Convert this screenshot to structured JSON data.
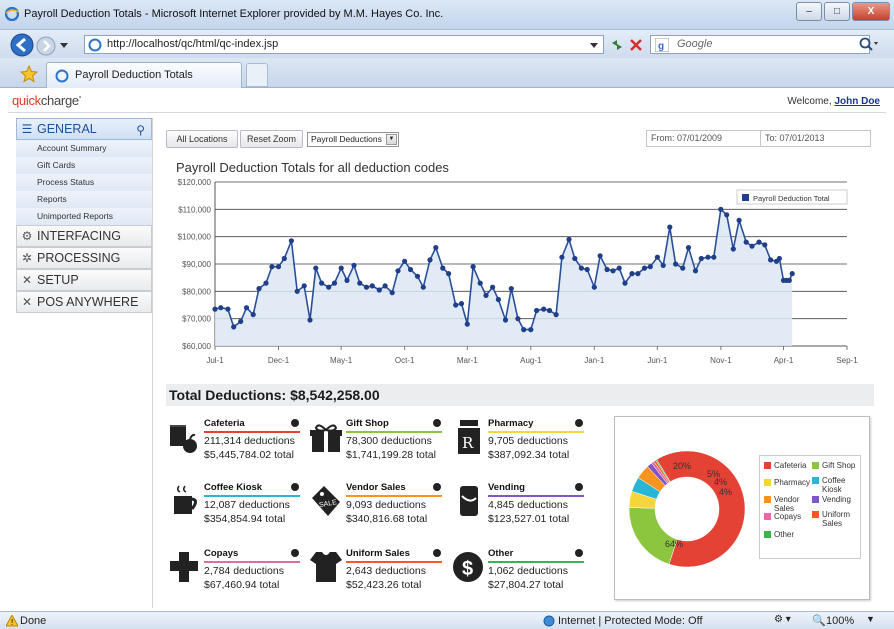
{
  "window": {
    "title": "Payroll Deduction Totals - Microsoft Internet Explorer provided by M.M. Hayes Co. Inc.",
    "minimize": "–",
    "maximize": "□",
    "close": "X"
  },
  "browser": {
    "url": "http://localhost/qc/html/qc-index.jsp",
    "search_placeholder": "Google",
    "tab_label": "Payroll Deduction Totals"
  },
  "app": {
    "logo_q": "quick",
    "logo_c": "charge",
    "logo_mark": "•",
    "welcome_prefix": "Welcome, ",
    "user_name": "John Doe"
  },
  "nav": {
    "general": "GENERAL",
    "general_items": [
      "Account Summary",
      "Gift Cards",
      "Process Status",
      "Reports",
      "Unimported Reports"
    ],
    "interfacing": "INTERFACING",
    "processing": "PROCESSING",
    "setup": "SETUP",
    "pos": "POS ANYWHERE"
  },
  "toolbar": {
    "all_locations": "All Locations",
    "reset_zoom": "Reset Zoom",
    "dropdown_value": "Payroll Deductions",
    "from_label": "From: ",
    "from_value": "07/01/2009",
    "to_label": "To: ",
    "to_value": "07/01/2013"
  },
  "chart_data": {
    "type": "area",
    "title": "Payroll Deduction Totals for all deduction codes",
    "series_name": "Payroll Deduction Total",
    "ylim": [
      60000,
      120000
    ],
    "y_ticks": [
      "$60,000",
      "$70,000",
      "$80,000",
      "$90,000",
      "$100,000",
      "$110,000",
      "$120,000"
    ],
    "y_tick_values": [
      60000,
      70000,
      80000,
      90000,
      100000,
      110000,
      120000
    ],
    "x_ticks": [
      "Jul-1",
      "Dec-1",
      "May-1",
      "Oct-1",
      "Mar-1",
      "Aug-1",
      "Jan-1",
      "Jun-1",
      "Nov-1",
      "Apr-1",
      "Sep-1"
    ],
    "x_tick_dates": [
      "2009-07-01",
      "2009-12-01",
      "2010-05-01",
      "2010-10-01",
      "2011-03-01",
      "2011-08-01",
      "2012-01-01",
      "2012-06-01",
      "2012-11-01",
      "2013-04-01",
      "2013-09-01"
    ],
    "x_range": [
      "2009-07-01",
      "2013-09-01"
    ],
    "points": [
      [
        "2009-07-01",
        73500
      ],
      [
        "2009-07-15",
        74000
      ],
      [
        "2009-08-01",
        73500
      ],
      [
        "2009-08-15",
        67000
      ],
      [
        "2009-09-01",
        69000
      ],
      [
        "2009-09-15",
        74000
      ],
      [
        "2009-10-01",
        71500
      ],
      [
        "2009-10-15",
        81000
      ],
      [
        "2009-11-01",
        83000
      ],
      [
        "2009-11-15",
        89000
      ],
      [
        "2009-12-01",
        89000
      ],
      [
        "2009-12-15",
        92000
      ],
      [
        "2010-01-01",
        98500
      ],
      [
        "2010-01-15",
        80000
      ],
      [
        "2010-02-01",
        82000
      ],
      [
        "2010-02-15",
        69500
      ],
      [
        "2010-03-01",
        88500
      ],
      [
        "2010-03-15",
        83000
      ],
      [
        "2010-04-01",
        81500
      ],
      [
        "2010-04-15",
        83000
      ],
      [
        "2010-05-01",
        88500
      ],
      [
        "2010-05-15",
        84000
      ],
      [
        "2010-06-01",
        89500
      ],
      [
        "2010-06-15",
        83000
      ],
      [
        "2010-07-01",
        81500
      ],
      [
        "2010-07-15",
        82000
      ],
      [
        "2010-08-01",
        80500
      ],
      [
        "2010-08-15",
        82000
      ],
      [
        "2010-09-01",
        79500
      ],
      [
        "2010-09-15",
        87500
      ],
      [
        "2010-10-01",
        91000
      ],
      [
        "2010-10-15",
        88000
      ],
      [
        "2010-11-01",
        85500
      ],
      [
        "2010-11-15",
        81500
      ],
      [
        "2010-12-01",
        91500
      ],
      [
        "2010-12-15",
        96000
      ],
      [
        "2011-01-01",
        88500
      ],
      [
        "2011-01-15",
        86500
      ],
      [
        "2011-02-01",
        75000
      ],
      [
        "2011-02-15",
        75500
      ],
      [
        "2011-03-01",
        68000
      ],
      [
        "2011-03-15",
        89000
      ],
      [
        "2011-04-01",
        83000
      ],
      [
        "2011-04-15",
        78500
      ],
      [
        "2011-05-01",
        81500
      ],
      [
        "2011-05-15",
        77000
      ],
      [
        "2011-06-01",
        69500
      ],
      [
        "2011-06-15",
        81000
      ],
      [
        "2011-07-01",
        70000
      ],
      [
        "2011-07-15",
        66000
      ],
      [
        "2011-08-01",
        66000
      ],
      [
        "2011-08-15",
        73000
      ],
      [
        "2011-09-01",
        73500
      ],
      [
        "2011-09-15",
        73000
      ],
      [
        "2011-10-01",
        71500
      ],
      [
        "2011-10-15",
        92500
      ],
      [
        "2011-11-01",
        99000
      ],
      [
        "2011-11-15",
        92000
      ],
      [
        "2011-12-01",
        88500
      ],
      [
        "2011-12-15",
        88000
      ],
      [
        "2012-01-01",
        81500
      ],
      [
        "2012-01-15",
        93000
      ],
      [
        "2012-02-01",
        88000
      ],
      [
        "2012-02-15",
        87500
      ],
      [
        "2012-03-01",
        88500
      ],
      [
        "2012-03-15",
        83000
      ],
      [
        "2012-04-01",
        86500
      ],
      [
        "2012-04-15",
        86500
      ],
      [
        "2012-05-01",
        88500
      ],
      [
        "2012-05-15",
        89000
      ],
      [
        "2012-06-01",
        92500
      ],
      [
        "2012-06-15",
        89500
      ],
      [
        "2012-07-01",
        103500
      ],
      [
        "2012-07-15",
        90000
      ],
      [
        "2012-08-01",
        88500
      ],
      [
        "2012-08-15",
        96000
      ],
      [
        "2012-09-01",
        87500
      ],
      [
        "2012-09-15",
        92000
      ],
      [
        "2012-10-01",
        92500
      ],
      [
        "2012-10-15",
        92500
      ],
      [
        "2012-11-01",
        110000
      ],
      [
        "2012-11-15",
        108000
      ],
      [
        "2012-12-01",
        95500
      ],
      [
        "2012-12-15",
        106000
      ],
      [
        "2013-01-01",
        98000
      ],
      [
        "2013-01-15",
        96500
      ],
      [
        "2013-02-01",
        98000
      ],
      [
        "2013-02-15",
        97000
      ],
      [
        "2013-03-01",
        91500
      ],
      [
        "2013-03-15",
        91000
      ],
      [
        "2013-03-22",
        92000
      ],
      [
        "2013-04-01",
        84000
      ],
      [
        "2013-04-08",
        84000
      ],
      [
        "2013-04-15",
        84000
      ],
      [
        "2013-04-22",
        86500
      ]
    ],
    "legend_position": "top-right",
    "grid": true
  },
  "totals": {
    "heading": "Total Deductions: $8,542,258.00"
  },
  "categories": [
    {
      "name": "Cafeteria",
      "count": "211,314 deductions",
      "total": "$5,445,784.02 total",
      "color": "#e34234",
      "icon": "cup-apple-icon"
    },
    {
      "name": "Gift Shop",
      "count": "78,300 deductions",
      "total": "$1,741,199.28 total",
      "color": "#8cc63f",
      "icon": "gift-box-icon"
    },
    {
      "name": "Pharmacy",
      "count": "9,705 deductions",
      "total": "$387,092.34 total",
      "color": "#f5d53b",
      "icon": "rx-bottle-icon"
    },
    {
      "name": "Coffee Kiosk",
      "count": "12,087 deductions",
      "total": "$354,854.94 total",
      "color": "#29b5d6",
      "icon": "coffee-mug-icon"
    },
    {
      "name": "Vendor Sales",
      "count": "9,093 deductions",
      "total": "$340,816.68 total",
      "color": "#f7931e",
      "icon": "sale-tag-icon"
    },
    {
      "name": "Vending",
      "count": "4,845 deductions",
      "total": "$123,527.01 total",
      "color": "#7e57c2",
      "icon": "soda-can-icon"
    },
    {
      "name": "Copays",
      "count": "2,784 deductions",
      "total": "$67,460.94 total",
      "color": "#e36aa6",
      "icon": "medical-cross-icon"
    },
    {
      "name": "Uniform Sales",
      "count": "2,643 deductions",
      "total": "$52,423.26 total",
      "color": "#f05a28",
      "icon": "tshirt-icon"
    },
    {
      "name": "Other",
      "count": "1,062 deductions",
      "total": "$27,804.27 total",
      "color": "#39b54a",
      "icon": "dollar-icon"
    }
  ],
  "donut": {
    "label_cafeteria": "64%",
    "label_gift": "20%",
    "label_pharmacy": "5%",
    "label_coffee": "4%",
    "label_vendor": "4%",
    "legend": [
      {
        "name": "Cafeteria",
        "color": "#e34234"
      },
      {
        "name": "Gift Shop",
        "color": "#8cc63f"
      },
      {
        "name": "Pharmacy",
        "color": "#f5d53b"
      },
      {
        "name": "Coffee Kiosk",
        "color": "#29b5d6"
      },
      {
        "name": "Vendor Sales",
        "color": "#f7931e"
      },
      {
        "name": "Vending",
        "color": "#7e57c2"
      },
      {
        "name": "Copays",
        "color": "#e36aa6"
      },
      {
        "name": "Uniform Sales",
        "color": "#f05a28"
      },
      {
        "name": "Other",
        "color": "#39b54a"
      }
    ],
    "values": [
      5445784.02,
      1741199.28,
      387092.34,
      354854.94,
      340816.68,
      123527.01,
      67460.94,
      52423.26,
      27804.27
    ]
  },
  "status": {
    "left": "Done",
    "zone": "Internet | Protected Mode: Off",
    "zoom": "100%"
  }
}
